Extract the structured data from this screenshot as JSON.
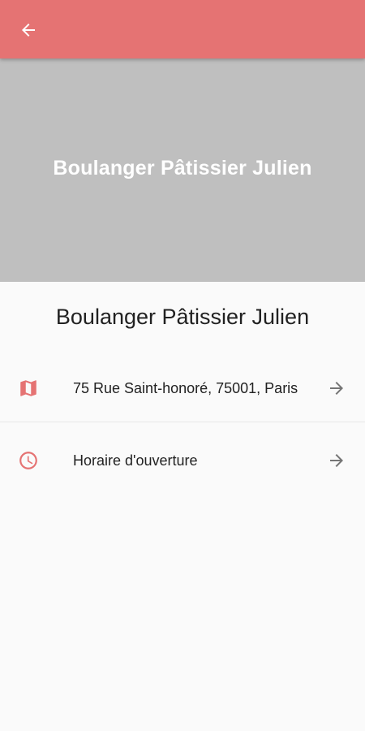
{
  "app_bar": {
    "back_icon": "arrow-left-icon",
    "background": "#e57373"
  },
  "hero": {
    "title": "Boulanger Pâtissier Julien",
    "background": "#bfbfbf"
  },
  "shop": {
    "name": "Boulanger Pâtissier Julien"
  },
  "items": [
    {
      "icon": "map-icon",
      "label": "75 Rue Saint-honoré, 75001, Paris",
      "action_icon": "arrow-right-icon"
    },
    {
      "icon": "clock-icon",
      "label": "Horaire d'ouverture",
      "action_icon": "arrow-right-icon"
    }
  ],
  "colors": {
    "accent": "#e57373",
    "icon_muted": "#757575"
  }
}
